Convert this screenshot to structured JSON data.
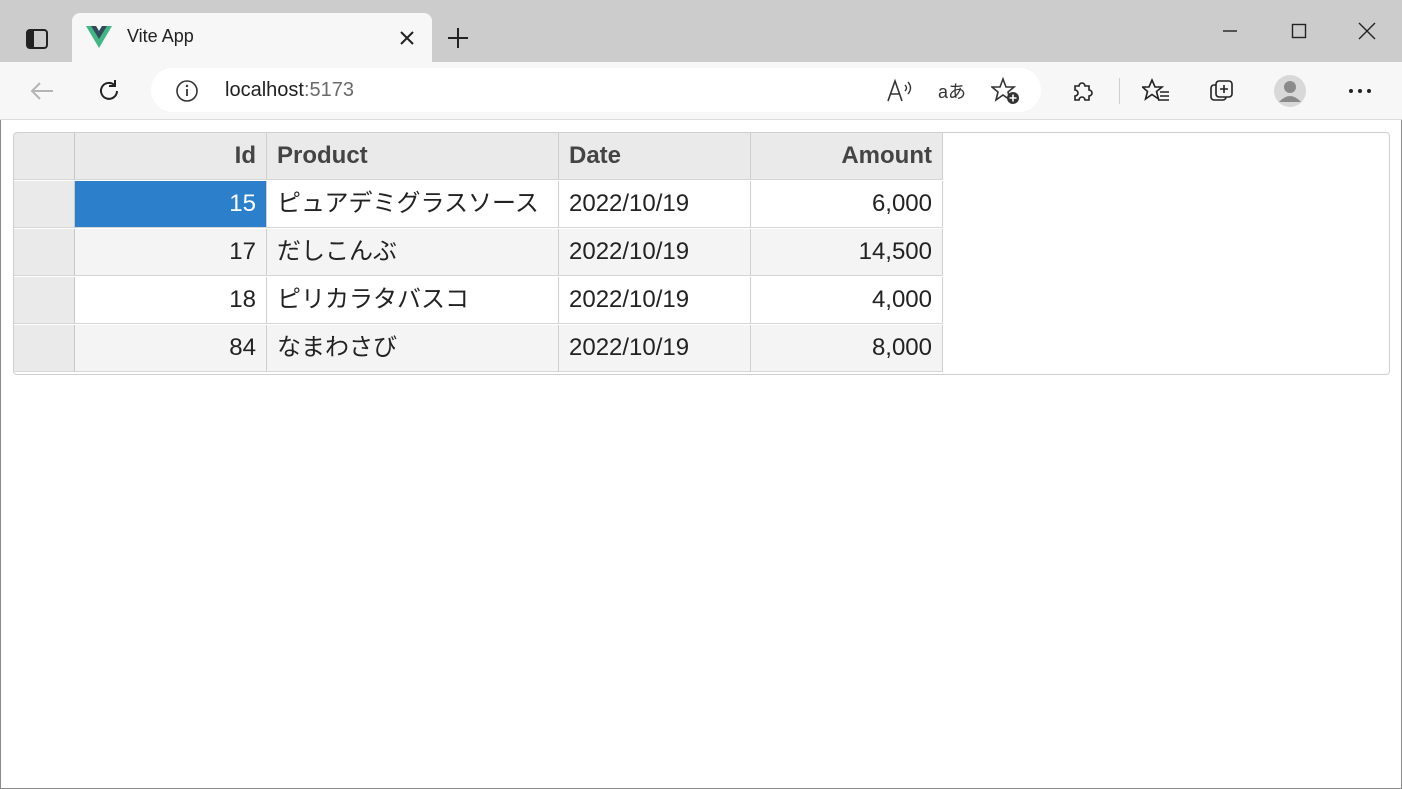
{
  "browser": {
    "tab": {
      "title": "Vite App"
    },
    "address": {
      "host": "localhost",
      "port": ":5173"
    },
    "icons": {
      "tab_actions": "tab-actions-icon",
      "favicon": "vue-logo-icon",
      "close": "close-icon",
      "new_tab": "plus-icon",
      "minimize": "minimize-icon",
      "maximize": "maximize-icon",
      "window_close": "close-icon",
      "back": "back-arrow-icon",
      "refresh": "refresh-icon",
      "site_info": "info-icon",
      "read_aloud": "read-aloud-icon",
      "translate": "translate-icon",
      "add_favorite": "star-plus-icon",
      "extensions": "puzzle-icon",
      "favorites": "favorites-icon",
      "collections": "collections-icon",
      "profile": "avatar-icon",
      "more": "more-icon"
    },
    "translate_label": "aあ"
  },
  "grid": {
    "headers": {
      "id": "Id",
      "product": "Product",
      "date": "Date",
      "amount": "Amount"
    },
    "rows": [
      {
        "id": "15",
        "product": "ピュアデミグラスソース",
        "date": "2022/10/19",
        "amount": "6,000"
      },
      {
        "id": "17",
        "product": "だしこんぶ",
        "date": "2022/10/19",
        "amount": "14,500"
      },
      {
        "id": "18",
        "product": "ピリカラタバスコ",
        "date": "2022/10/19",
        "amount": "4,000"
      },
      {
        "id": "84",
        "product": "なまわさび",
        "date": "2022/10/19",
        "amount": "8,000"
      }
    ],
    "selected_cell": "row 0, Id"
  },
  "colors": {
    "selection": "#2b7fcb",
    "header_bg": "#eaeaea",
    "chrome_bg": "#cccccc"
  }
}
